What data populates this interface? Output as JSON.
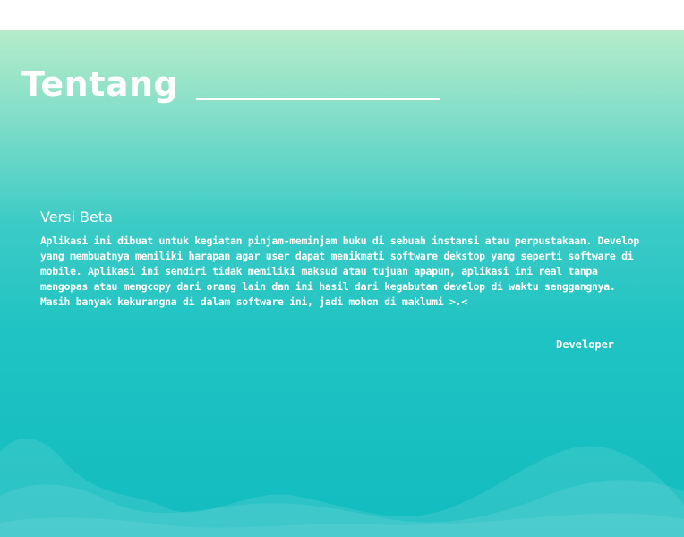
{
  "page": {
    "title": "Tentang",
    "version_label": "Versi Beta",
    "description": "Aplikasi ini dibuat untuk kegiatan pinjam-meminjam buku di sebuah instansi atau perpustakaan. Develop yang membuatnya memiliki harapan agar user dapat menikmati software dekstop yang seperti software di mobile. Aplikasi ini sendiri tidak memiliki maksud atau tujuan apapun, aplikasi ini real tanpa mengopas atau mengcopy dari orang lain dan ini hasil dari kegabutan develop di waktu senggangnya. Masih banyak kekurangna di dalam software ini, jadi mohon di maklumi >.<",
    "signature": "Developer"
  },
  "colors": {
    "gradient_top": "#b5ecc9",
    "gradient_bottom": "#12bcbf",
    "text": "#ffffff"
  }
}
